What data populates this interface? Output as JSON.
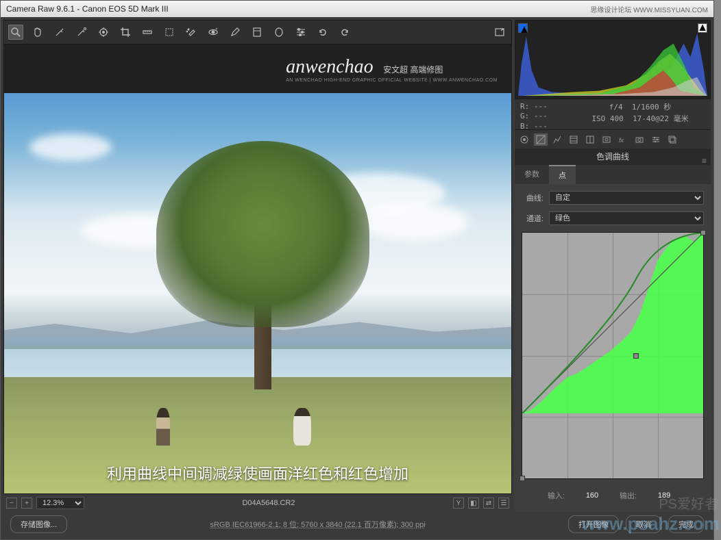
{
  "titlebar": {
    "title": "Camera Raw 9.6.1  -   Canon EOS 5D Mark III",
    "source_site": "思缘设计论坛  WWW.MISSYUAN.COM"
  },
  "watermark": {
    "main": "anwenchao",
    "sub": "安文超 高端修图",
    "sub2": "AN WENCHAO HIGH-END GRAPHIC OFFICIAL WEBSITE | WWW.ANWENCHAO.COM"
  },
  "caption": "利用曲线中间调减绿使画面洋红色和红色增加",
  "info": {
    "R": "R:  ---",
    "G": "G:  ---",
    "B": "B:  ---",
    "aperture": "f/4",
    "shutter": "1/1600 秒",
    "iso": "ISO 400",
    "lens": "17-40@22 毫米"
  },
  "panel": {
    "title": "色调曲线",
    "subtabs": {
      "params": "参数",
      "point": "点"
    },
    "curve_label": "曲线:",
    "curve_value": "自定",
    "channel_label": "通道:",
    "channel_value": "绿色",
    "input_label": "输入:",
    "input_value": "160",
    "output_label": "输出:",
    "output_value": "189"
  },
  "preview_footer": {
    "zoom": "12.3%",
    "filename": "D04A5648.CR2"
  },
  "footer": {
    "save": "存储图像...",
    "profile": "sRGB IEC61966-2.1; 8 位;  5760 x 3840 (22.1 百万像素); 300 ppi",
    "open": "打开图像",
    "cancel": "取消",
    "done": "完成"
  },
  "ps_watermark": {
    "top": "PS爱好者",
    "bottom": "www.psahz.com"
  }
}
